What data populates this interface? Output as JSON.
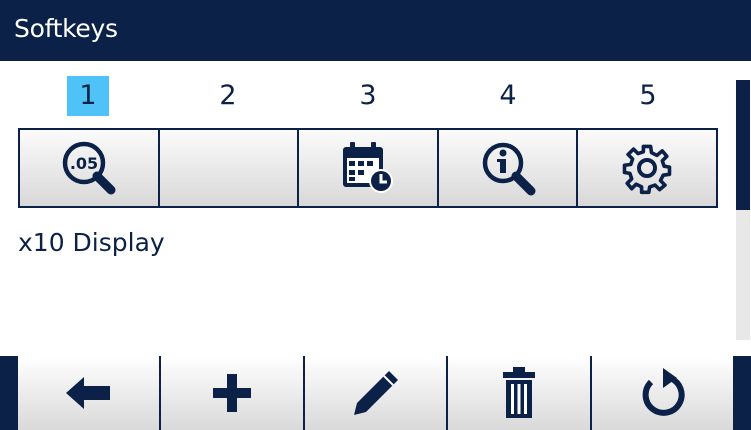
{
  "window": {
    "title": "Softkeys"
  },
  "softkey_numbers": [
    {
      "label": "1",
      "selected": true
    },
    {
      "label": "2",
      "selected": false
    },
    {
      "label": "3",
      "selected": false
    },
    {
      "label": "4",
      "selected": false
    },
    {
      "label": "5",
      "selected": false
    }
  ],
  "softkeys": [
    {
      "icon": "x10-display-zoom-icon",
      "zoom_text": ".05"
    },
    {
      "icon": "empty"
    },
    {
      "icon": "calendar-clock-icon"
    },
    {
      "icon": "info-search-icon"
    },
    {
      "icon": "gear-icon"
    }
  ],
  "selected_description": "x10 Display",
  "bottom_buttons": [
    {
      "icon": "arrow-left-icon"
    },
    {
      "icon": "plus-icon"
    },
    {
      "icon": "pencil-icon"
    },
    {
      "icon": "trash-icon"
    },
    {
      "icon": "refresh-icon"
    }
  ],
  "colors": {
    "navy": "#0c2147",
    "selection": "#4fc3f7"
  }
}
